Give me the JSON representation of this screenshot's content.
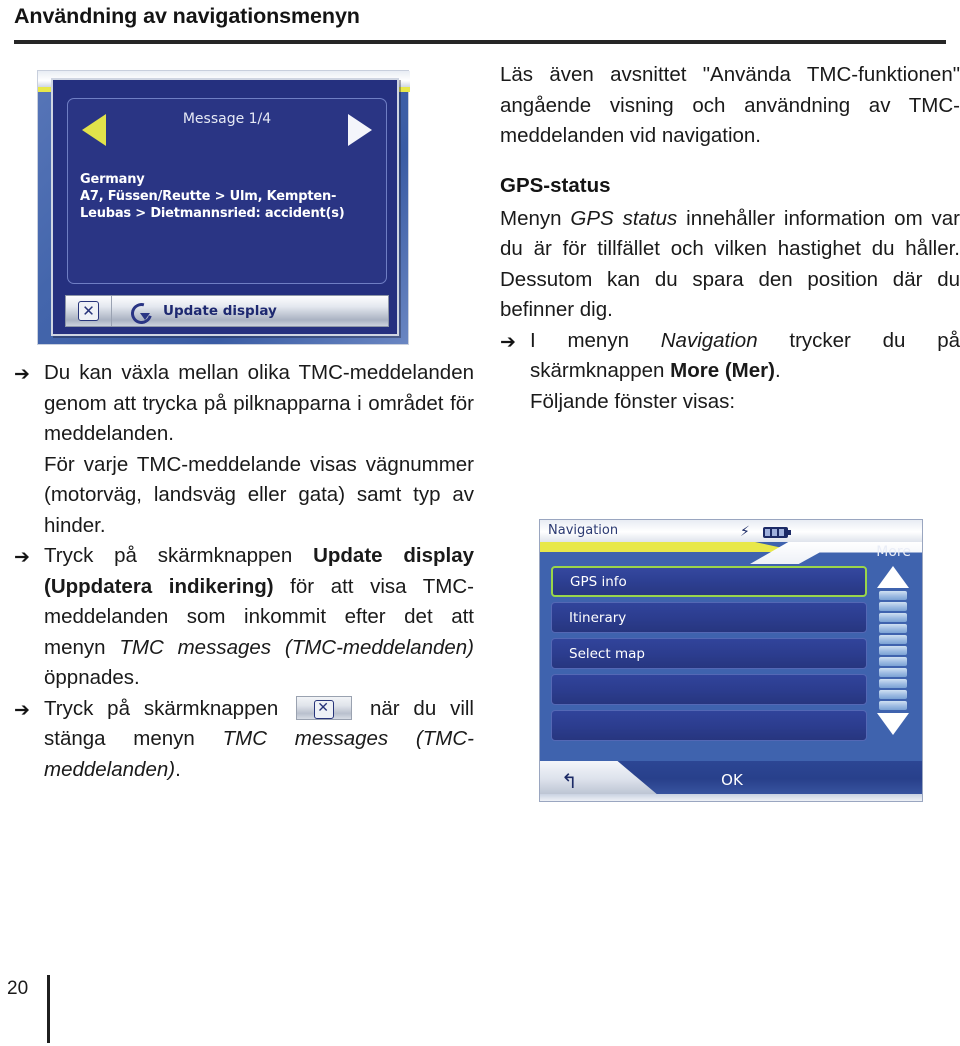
{
  "header": {
    "title": "Användning av navigationsmenyn"
  },
  "page_number": "20",
  "screenshot_tmc": {
    "message_title": "Message 1/4",
    "message_line1": "Germany",
    "message_line2": "A7, Füssen/Reutte > Ulm, Kempten-",
    "message_line3": "Leubas > Dietmannsried:  accident(s)",
    "close_glyph": "✕",
    "update_label": "Update display",
    "prev_arrow": "left-arrow",
    "next_arrow": "right-arrow"
  },
  "left_column": {
    "bullet1": {
      "arrow": "➔",
      "text": "Du kan växla mellan olika TMC-meddelanden genom att trycka på pilknapparna i området för meddelanden."
    },
    "para1": "För varje TMC-meddelande visas vägnummer (motorväg, landsväg eller gata) samt typ av hinder.",
    "bullet2": {
      "arrow": "➔",
      "part1": "Tryck på skärmknappen ",
      "bold1": "Update display (Uppdatera indikering)",
      "part2": " för att visa TMC-meddelanden som inkommit efter det att menyn ",
      "italic1": "TMC messages (TMC-meddelanden)",
      "part3": " öppnades."
    },
    "bullet3": {
      "arrow": "➔",
      "part1": "Tryck på skärmknappen ",
      "button_glyph": "✕",
      "part2": " när du vill stänga menyn ",
      "italic1": "TMC messages (TMC-meddelanden)",
      "part3": "."
    }
  },
  "right_column": {
    "para1": "Läs även avsnittet \"Använda TMC-funktionen\" angående visning och användning av TMC-meddelanden vid navigation.",
    "heading": "GPS-status",
    "para2": {
      "part1": "Menyn ",
      "italic1": "GPS status",
      "part2": " innehåller information om var du är för tillfället och vilken hastighet du håller. Dessutom kan du spara den position där du befinner dig."
    },
    "bullet1": {
      "arrow": "➔",
      "part1": "I menyn ",
      "italic1": "Navigation",
      "part2": " trycker du på skärmknappen ",
      "bold1": "More (Mer)",
      "part3": "."
    },
    "para3": "Följande fönster visas:"
  },
  "screenshot_navigation": {
    "title": "Navigation",
    "more_label": "More",
    "bolt_icon": "⚡",
    "battery_icon": "battery-icon",
    "items": [
      {
        "label": "GPS info",
        "selected": true
      },
      {
        "label": "Itinerary",
        "selected": false
      },
      {
        "label": "Select map",
        "selected": false
      },
      {
        "label": "",
        "selected": false
      },
      {
        "label": "",
        "selected": false
      }
    ],
    "scroll_up": "scroll-up-arrow",
    "scroll_down": "scroll-down-arrow",
    "scroll_segments": 11,
    "back_glyph": "↰",
    "ok_label": "OK"
  },
  "colors": {
    "rule": "#262626",
    "screen_blue": "#25307f",
    "nav_blue": "#3f63ae",
    "accent_yellow": "#e8e84a",
    "selection_green": "#9ad64a"
  }
}
